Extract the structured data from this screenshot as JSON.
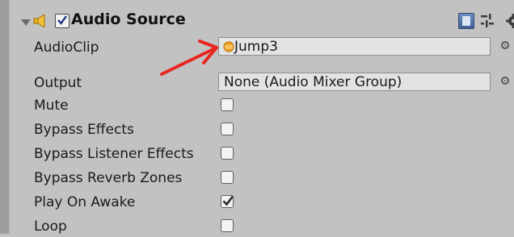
{
  "component": {
    "title": "Audio Source",
    "enabled": true,
    "icons": [
      "foldout-triangle-icon",
      "speaker-icon",
      "help-book-icon",
      "preset-settings-icon",
      "gear-icon"
    ]
  },
  "fields": {
    "audio_clip": {
      "label": "AudioClip",
      "value": "Jump3",
      "icon": "audio-clip-icon"
    },
    "output": {
      "label": "Output",
      "value": "None (Audio Mixer Group)"
    }
  },
  "toggles": [
    {
      "label": "Mute",
      "checked": false
    },
    {
      "label": "Bypass Effects",
      "checked": false
    },
    {
      "label": "Bypass Listener Effects",
      "checked": false
    },
    {
      "label": "Bypass Reverb Zones",
      "checked": false
    },
    {
      "label": "Play On Awake",
      "checked": true
    },
    {
      "label": "Loop",
      "checked": false
    }
  ],
  "annotation": {
    "type": "red-arrow",
    "color": "#e8261f",
    "points_to": "audio_clip"
  },
  "colors": {
    "panel_bg": "#c2c2c2",
    "field_bg": "#e3e3e3",
    "check_color": "#2a2a2a"
  }
}
